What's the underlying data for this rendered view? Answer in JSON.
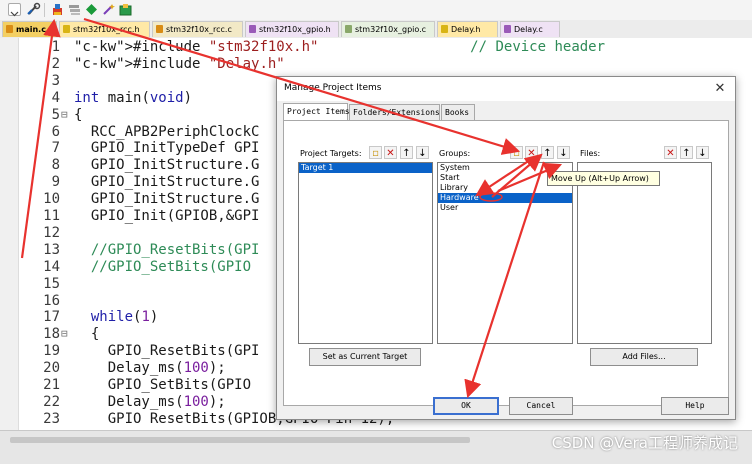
{
  "toolbar": {
    "icons": [
      "dropdown-icon",
      "settings-icon",
      "project-items-icon",
      "stack-icon",
      "diamond-icon",
      "wand-icon",
      "pack-icon"
    ]
  },
  "tabs": [
    {
      "label": "main.c",
      "active": true
    },
    {
      "label": "stm32f10x_rcc.h"
    },
    {
      "label": "stm32f10x_rcc.c"
    },
    {
      "label": "stm32f10x_gpio.h"
    },
    {
      "label": "stm32f10x_gpio.c"
    },
    {
      "label": "Delay.h"
    },
    {
      "label": "Delay.c"
    }
  ],
  "editor": {
    "lines": [
      {
        "n": "1",
        "text": "#include \"stm32f10x.h\"                  // Device header"
      },
      {
        "n": "2",
        "text": "#include \"Delay.h\""
      },
      {
        "n": "3",
        "text": ""
      },
      {
        "n": "4",
        "text": "int main(void)"
      },
      {
        "n": "5",
        "text": "{"
      },
      {
        "n": "6",
        "text": "  RCC_APB2PeriphClockC"
      },
      {
        "n": "7",
        "text": "  GPIO_InitTypeDef GPI"
      },
      {
        "n": "8",
        "text": "  GPIO_InitStructure.G"
      },
      {
        "n": "9",
        "text": "  GPIO_InitStructure.G"
      },
      {
        "n": "10",
        "text": "  GPIO_InitStructure.G"
      },
      {
        "n": "11",
        "text": "  GPIO_Init(GPIOB,&GPI"
      },
      {
        "n": "12",
        "text": ""
      },
      {
        "n": "13",
        "text": "  //GPIO_ResetBits(GPI"
      },
      {
        "n": "14",
        "text": "  //GPIO_SetBits(GPIO"
      },
      {
        "n": "15",
        "text": ""
      },
      {
        "n": "16",
        "text": ""
      },
      {
        "n": "17",
        "text": "  while(1)"
      },
      {
        "n": "18",
        "text": "  {"
      },
      {
        "n": "19",
        "text": "    GPIO_ResetBits(GPI"
      },
      {
        "n": "20",
        "text": "    Delay_ms(100);"
      },
      {
        "n": "21",
        "text": "    GPIO_SetBits(GPIO"
      },
      {
        "n": "22",
        "text": "    Delay_ms(100);"
      },
      {
        "n": "23",
        "text": "    GPIO ResetBits(GPIOB,GPIO Pin 12);"
      }
    ]
  },
  "watermark": "CSDN @Vera工程师养成记",
  "dialog": {
    "title": "Manage Project Items",
    "close": "✕",
    "tabs": [
      "Project Items",
      "Folders/Extensions",
      "Books"
    ],
    "targets": {
      "label": "Project Targets:",
      "items": [
        "Target 1"
      ],
      "selected": "Target 1"
    },
    "groups": {
      "label": "Groups:",
      "items": [
        "System",
        "Start",
        "Library",
        "Hardware",
        "User"
      ],
      "selected": "Hardware"
    },
    "files": {
      "label": "Files:",
      "items": []
    },
    "buttons": {
      "set_current": "Set as Current Target",
      "add_files": "Add Files...",
      "ok": "OK",
      "cancel": "Cancel",
      "help": "Help"
    },
    "tooltip": "Move Up (Alt+Up Arrow)"
  },
  "colors": {
    "selection": "#0a62c8",
    "annotation_arrow": "#e8322e",
    "active_tab": "#f3cf63",
    "comment": "#2e8b57",
    "keyword": "#1f1fa8",
    "string": "#9c1e1e"
  }
}
